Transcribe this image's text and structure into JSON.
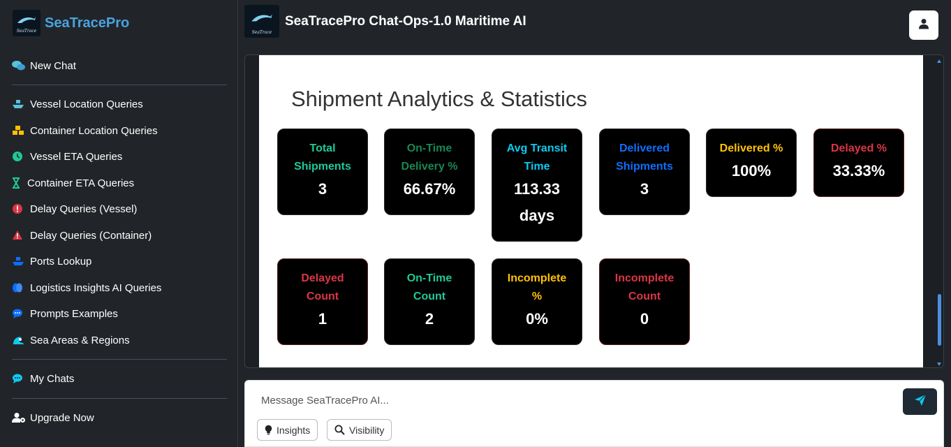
{
  "brand": {
    "name": "SeaTracePro",
    "logo_text": "SeaTrace"
  },
  "sidebar": {
    "new_chat": "New Chat",
    "items": [
      {
        "label": "Vessel Location Queries",
        "icon": "ship-icon"
      },
      {
        "label": "Container Location Queries",
        "icon": "containers-icon"
      },
      {
        "label": "Vessel ETA Queries",
        "icon": "clock-icon"
      },
      {
        "label": "Container ETA Queries",
        "icon": "hourglass-icon"
      },
      {
        "label": "Delay Queries (Vessel)",
        "icon": "alert-circle-icon"
      },
      {
        "label": "Delay Queries (Container)",
        "icon": "warning-icon"
      },
      {
        "label": "Ports Lookup",
        "icon": "port-icon"
      },
      {
        "label": "Logistics Insights AI Queries",
        "icon": "brain-icon"
      },
      {
        "label": "Prompts Examples",
        "icon": "chat-bubble-icon"
      },
      {
        "label": "Sea Areas & Regions",
        "icon": "wave-icon"
      }
    ],
    "my_chats": "My Chats",
    "upgrade": "Upgrade Now"
  },
  "header": {
    "title": "SeaTracePro Chat-Ops-1.0 Maritime AI"
  },
  "main": {
    "section_title": "Shipment Analytics & Statistics",
    "cards": [
      {
        "title_1": "Total",
        "title_2": "Shipments",
        "value_1": "3",
        "value_2": "",
        "color": "#20c997"
      },
      {
        "title_1": "On-Time",
        "title_2": "Delivery %",
        "value_1": "66.67%",
        "value_2": "",
        "color": "#198754"
      },
      {
        "title_1": "Avg Transit",
        "title_2": "Time",
        "value_1": "113.33",
        "value_2": "days",
        "color": "#0dcaf0"
      },
      {
        "title_1": "Delivered",
        "title_2": "Shipments",
        "value_1": "3",
        "value_2": "",
        "color": "#0d6efd"
      },
      {
        "title_1": "Delivered %",
        "title_2": "",
        "value_1": "100%",
        "value_2": "",
        "color": "#ffc107"
      },
      {
        "title_1": "Delayed %",
        "title_2": "",
        "value_1": "33.33%",
        "value_2": "",
        "color": "#dc3545"
      },
      {
        "title_1": "Delayed",
        "title_2": "Count",
        "value_1": "1",
        "value_2": "",
        "color": "#dc3545"
      },
      {
        "title_1": "On-Time",
        "title_2": "Count",
        "value_1": "2",
        "value_2": "",
        "color": "#20c997"
      },
      {
        "title_1": "Incomplete",
        "title_2": "%",
        "value_1": "0%",
        "value_2": "",
        "color": "#ffc107"
      },
      {
        "title_1": "Incomplete",
        "title_2": "Count",
        "value_1": "0",
        "value_2": "",
        "color": "#dc3545"
      }
    ]
  },
  "composer": {
    "placeholder": "Message SeaTracePro AI...",
    "chips": [
      "Insights",
      "Visibility"
    ]
  },
  "colors": {
    "accent": "#4aa3df",
    "send_icon": "#0dcaf0",
    "sidebar_bg": "#212529"
  }
}
